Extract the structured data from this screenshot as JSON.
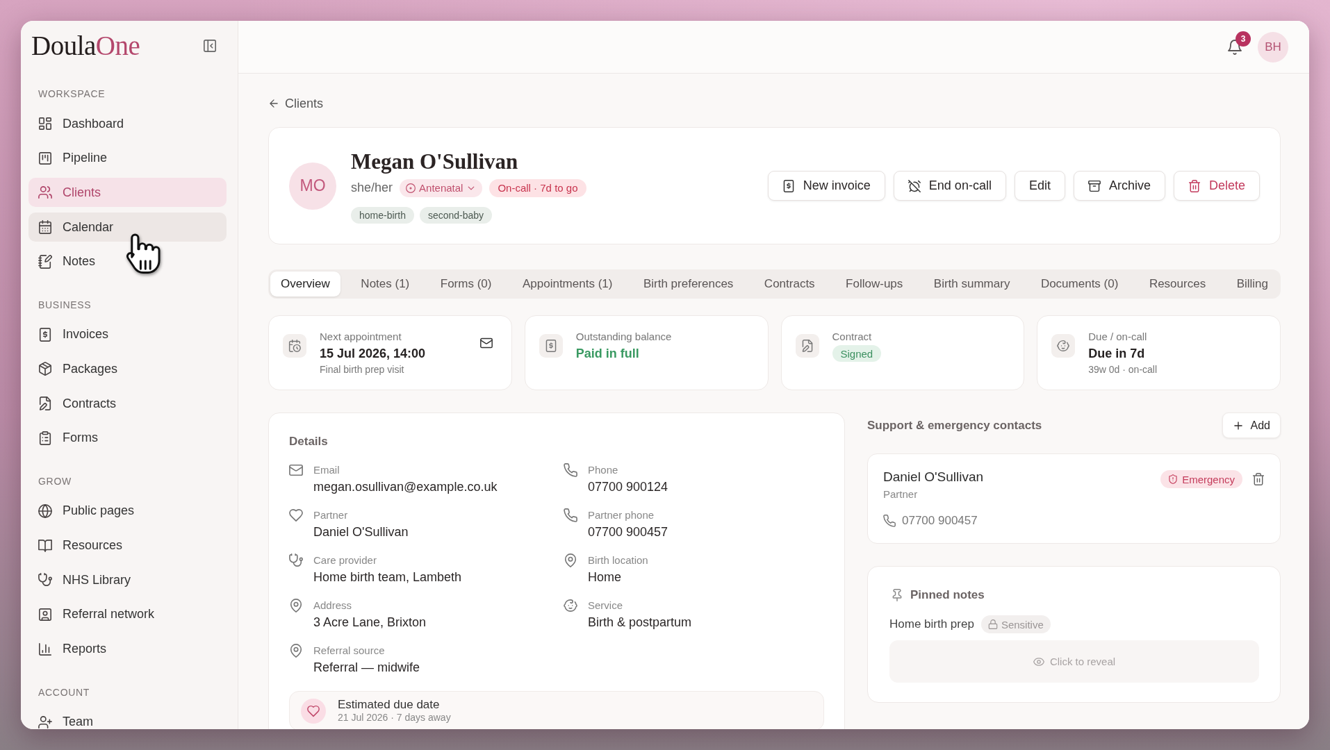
{
  "sidebar": {
    "logo": {
      "text": "Doula",
      "accent": "One"
    },
    "sections": [
      {
        "title": "WORKSPACE",
        "items": [
          {
            "label": "Dashboard",
            "selected": false,
            "hovered": false
          },
          {
            "label": "Pipeline",
            "selected": false,
            "hovered": false
          },
          {
            "label": "Clients",
            "selected": true,
            "hovered": false
          },
          {
            "label": "Calendar",
            "selected": false,
            "hovered": true
          },
          {
            "label": "Notes",
            "selected": false,
            "hovered": false
          }
        ]
      },
      {
        "title": "BUSINESS",
        "items": [
          {
            "label": "Invoices",
            "selected": false,
            "hovered": false
          },
          {
            "label": "Packages",
            "selected": false,
            "hovered": false
          },
          {
            "label": "Contracts",
            "selected": false,
            "hovered": false
          },
          {
            "label": "Forms",
            "selected": false,
            "hovered": false
          }
        ]
      },
      {
        "title": "GROW",
        "items": [
          {
            "label": "Public pages",
            "selected": false,
            "hovered": false
          },
          {
            "label": "Resources",
            "selected": false,
            "hovered": false
          },
          {
            "label": "NHS Library",
            "selected": false,
            "hovered": false
          },
          {
            "label": "Referral network",
            "selected": false,
            "hovered": false
          },
          {
            "label": "Reports",
            "selected": false,
            "hovered": false
          }
        ]
      },
      {
        "title": "ACCOUNT",
        "items": [
          {
            "label": "Team",
            "selected": false,
            "hovered": false
          }
        ]
      }
    ]
  },
  "top_bar": {
    "notification_count": "3",
    "user_initials": "BH"
  },
  "back_link": "Clients",
  "client": {
    "initials": "MO",
    "name": "Megan O'Sullivan",
    "pronouns": "she/her",
    "stage": "Antenatal",
    "on_call": "On-call · 7d to go",
    "tags": [
      "home-birth",
      "second-baby"
    ]
  },
  "actions": [
    {
      "label": "New invoice",
      "kind": "default"
    },
    {
      "label": "End on-call",
      "kind": "default"
    },
    {
      "label": "Edit",
      "kind": "default"
    },
    {
      "label": "Archive",
      "kind": "default"
    },
    {
      "label": "Delete",
      "kind": "danger"
    }
  ],
  "tabs": [
    {
      "label": "Overview",
      "selected": true
    },
    {
      "label": "Notes (1)",
      "selected": false
    },
    {
      "label": "Forms (0)",
      "selected": false
    },
    {
      "label": "Appointments (1)",
      "selected": false
    },
    {
      "label": "Birth preferences",
      "selected": false
    },
    {
      "label": "Contracts",
      "selected": false
    },
    {
      "label": "Follow-ups",
      "selected": false
    },
    {
      "label": "Birth summary",
      "selected": false
    },
    {
      "label": "Documents (0)",
      "selected": false
    },
    {
      "label": "Resources",
      "selected": false
    },
    {
      "label": "Billing",
      "selected": false
    }
  ],
  "summary_cards": [
    {
      "label": "Next appointment",
      "value": "15 Jul 2026, 14:00",
      "kind": "plain",
      "subtitle": "Final birth prep visit",
      "mail_button": true
    },
    {
      "label": "Outstanding balance",
      "value": "Paid in full",
      "kind": "positive"
    },
    {
      "label": "Contract",
      "value": "Signed",
      "kind": "badge"
    },
    {
      "label": "Due / on-call",
      "value": "Due in 7d",
      "kind": "plain",
      "subtitle": "39w 0d · on-call"
    }
  ],
  "details": {
    "title": "Details",
    "fields": [
      {
        "label": "Email",
        "value": "megan.osullivan@example.co.uk"
      },
      {
        "label": "Phone",
        "value": "07700 900124"
      },
      {
        "label": "Partner",
        "value": "Daniel O'Sullivan"
      },
      {
        "label": "Partner phone",
        "value": "07700 900457"
      },
      {
        "label": "Care provider",
        "value": "Home birth team, Lambeth"
      },
      {
        "label": "Birth location",
        "value": "Home"
      },
      {
        "label": "Address",
        "value": "3 Acre Lane, Brixton"
      },
      {
        "label": "Service",
        "value": "Birth & postpartum"
      },
      {
        "label": "Referral source",
        "value": "Referral — midwife"
      }
    ],
    "due_date": {
      "title": "Estimated due date",
      "subtitle": "21 Jul 2026 · 7 days away"
    }
  },
  "contacts": {
    "title": "Support & emergency contacts",
    "add_button": "Add",
    "items": [
      {
        "name": "Daniel O'Sullivan",
        "relation": "Partner",
        "phone": "07700 900457",
        "badge": "Emergency"
      }
    ]
  },
  "pinned_notes": {
    "title": "Pinned notes",
    "notes": [
      {
        "title": "Home birth prep",
        "tag": "Sensitive",
        "reveal_label": "Click to reveal"
      }
    ]
  }
}
